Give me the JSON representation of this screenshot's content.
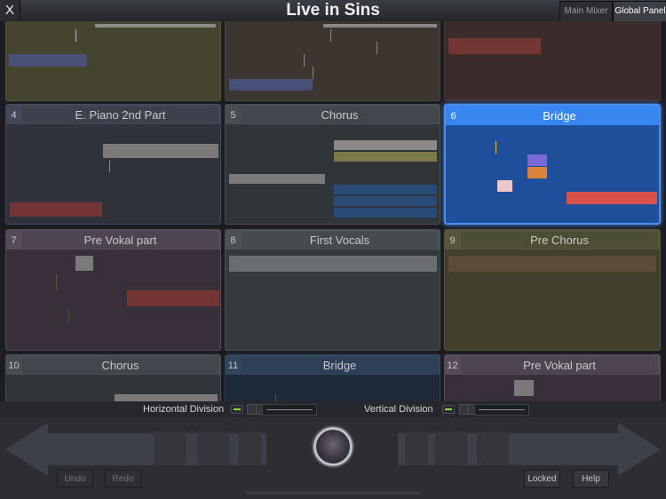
{
  "app": {
    "close_label": "X",
    "title": "Live in Sins",
    "main_mixer_label": "Main Mixer",
    "global_panel_label": "Global Panel"
  },
  "scenes": [
    {
      "num": "",
      "name": "",
      "color": "#4a4a34"
    },
    {
      "num": "",
      "name": "",
      "color": "#3f3a33"
    },
    {
      "num": "",
      "name": "",
      "color": "#3d2d2c"
    },
    {
      "num": "4",
      "name": "E. Piano 2nd Part",
      "color": "#3a3f4d"
    },
    {
      "num": "5",
      "name": "Chorus",
      "color": "#3f4449"
    },
    {
      "num": "6",
      "name": "Bridge",
      "color": "#2f6fd0",
      "selected": true
    },
    {
      "num": "7",
      "name": "Pre Vokal part",
      "color": "#4a3f4d"
    },
    {
      "num": "8",
      "name": "First Vocals",
      "color": "#3f4447"
    },
    {
      "num": "9",
      "name": "Pre Chorus",
      "color": "#494a36"
    },
    {
      "num": "10",
      "name": "Chorus",
      "color": "#3f4449"
    },
    {
      "num": "11",
      "name": "Bridge",
      "color": "#2f3f5a"
    },
    {
      "num": "12",
      "name": "Pre Vokal part",
      "color": "#4a3f4d"
    }
  ],
  "division": {
    "horizontal_label": "Horizontal Division",
    "vertical_label": "Vertical Division"
  },
  "controls": {
    "undo_label": "Undo",
    "redo_label": "Redo",
    "locked_label": "Locked",
    "help_label": "Help"
  }
}
